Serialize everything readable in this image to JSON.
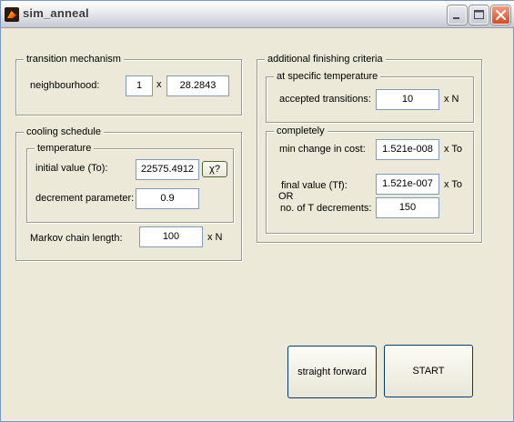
{
  "window": {
    "title": "sim_anneal"
  },
  "transition_mechanism": {
    "title": "transition mechanism",
    "neighbourhood_label": "neighbourhood:",
    "multiplier_value": "1",
    "times_symbol": "x",
    "neighbourhood_value": "28.2843"
  },
  "cooling_schedule": {
    "title": "cooling schedule",
    "temperature": {
      "title": "temperature",
      "initial_label": "initial value (To):",
      "initial_value": "22575.4912",
      "chi_button_label": "χ?",
      "decrement_label": "decrement  parameter:",
      "decrement_value": "0.9"
    },
    "markov_label": "Markov chain length:",
    "markov_value": "100",
    "markov_unit": "x N"
  },
  "finishing": {
    "title": "additional finishing criteria",
    "at_temperature": {
      "title": "at specific temperature",
      "accepted_label": "accepted transitions:",
      "accepted_value": "10",
      "accepted_unit": "x N"
    },
    "completely": {
      "title": "completely",
      "min_change_label": "min change in cost:",
      "min_change_value": "1.521e-008",
      "min_change_unit": "x To",
      "final_label": "final value (Tf):",
      "final_value": "1.521e-007",
      "final_unit": "x To",
      "or_label": "OR",
      "decrements_label": "no. of T decrements:",
      "decrements_value": "150"
    }
  },
  "buttons": {
    "straight_forward": "straight forward",
    "start": "START"
  }
}
